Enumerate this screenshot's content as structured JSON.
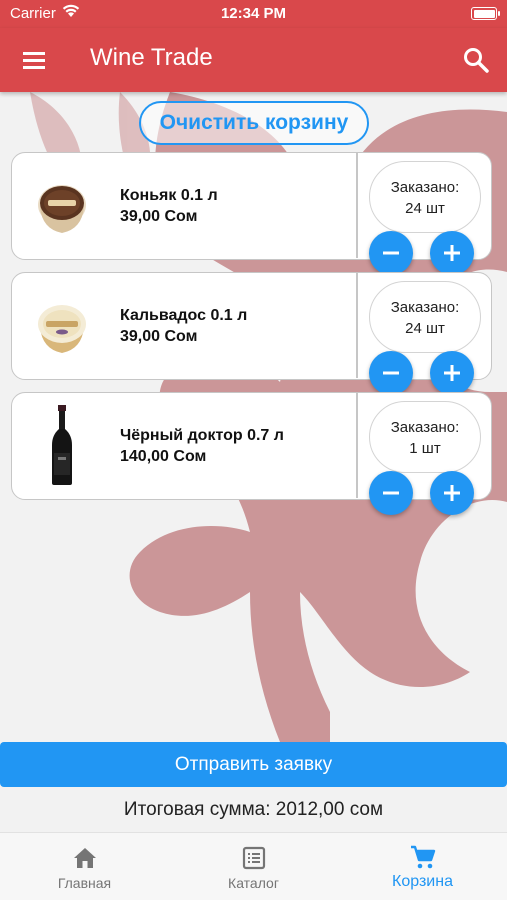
{
  "status_bar": {
    "carrier": "Carrier",
    "time": "12:34 PM"
  },
  "app_bar": {
    "title": "Wine Trade",
    "menu_icon": "menu-icon",
    "search_icon": "search-icon"
  },
  "clear_cart_label": "Очистить корзину",
  "cart_items": [
    {
      "name": "Коньяк 0.1 л",
      "price": "39,00 Сом",
      "ordered_label": "Заказано:",
      "quantity": "24 шт",
      "image": "cognac-cup-image"
    },
    {
      "name": "Кальвадос 0.1 л",
      "price": "39,00 Сом",
      "ordered_label": "Заказано:",
      "quantity": "24 шт",
      "image": "calvados-cup-image"
    },
    {
      "name": "Чёрный доктор 0.7 л",
      "price": "140,00 Сом",
      "ordered_label": "Заказано:",
      "quantity": "1 шт",
      "image": "wine-bottle-image"
    }
  ],
  "submit_label": "Отправить заявку",
  "total_text": "Итоговая сумма: 2012,00 сом",
  "bottom_nav": [
    {
      "label": "Главная",
      "icon": "home-icon",
      "active": false
    },
    {
      "label": "Каталог",
      "icon": "catalog-icon",
      "active": false
    },
    {
      "label": "Корзина",
      "icon": "cart-icon",
      "active": true
    }
  ],
  "colors": {
    "app_bar": "#d9484b",
    "accent": "#2196f3",
    "background": "#f2f2f2",
    "leaf": "#b0585c"
  }
}
